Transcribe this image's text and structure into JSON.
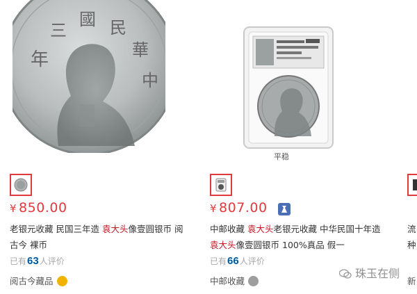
{
  "products": [
    {
      "currency": "¥",
      "price": "850.00",
      "title_pre": "老银元收藏 民国三年造 ",
      "title_hl": "袁大头",
      "title_post": "像壹圆银币 阅古今 裸币",
      "comments_pre": "已有",
      "comments_count": "63",
      "comments_post": "人评价",
      "shop": "阅古今藏品",
      "shop_icon_color": "#f0b400"
    },
    {
      "currency": "¥",
      "price": "807.00",
      "badge_icon": "gift-icon",
      "image_label": "平稳",
      "title_pre": "中邮收藏 ",
      "title_hl": "袁大头",
      "title_mid": "老银元收藏 中华民国十年造 ",
      "title_hl2": "袁大头",
      "title_post": "像壹圆银币 100%真品 假一",
      "comments_pre": "已有",
      "comments_count": "66",
      "comments_post": "人评价",
      "shop": "中邮收藏",
      "shop_icon_color": "#9e9e9e"
    },
    {
      "title_line1": "流",
      "title_line2": "种",
      "shop": "新"
    }
  ],
  "watermark": "珠玉在侧",
  "colors": {
    "price": "#e4393c",
    "highlight": "#c81623",
    "count": "#005aa0"
  }
}
